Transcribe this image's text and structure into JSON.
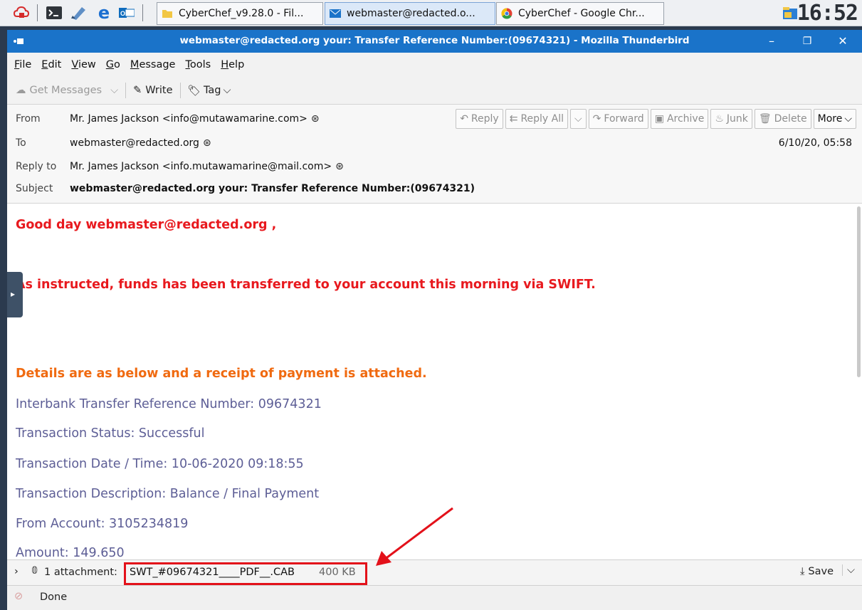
{
  "taskbar": {
    "tasks": [
      {
        "label": "CyberChef_v9.28.0 - Fil..."
      },
      {
        "label": "webmaster@redacted.o..."
      },
      {
        "label": "CyberChef - Google Chr..."
      }
    ],
    "clock": "16:52"
  },
  "window": {
    "title": "webmaster@redacted.org your: Transfer Reference Number:(09674321) - Mozilla Thunderbird",
    "minimize": "–",
    "restore": "❐",
    "close": "✕"
  },
  "menubar": {
    "items": [
      {
        "key": "F",
        "rest": "ile"
      },
      {
        "key": "E",
        "rest": "dit"
      },
      {
        "key": "V",
        "rest": "iew"
      },
      {
        "key": "G",
        "rest": "o"
      },
      {
        "key": "M",
        "rest": "essage"
      },
      {
        "key": "T",
        "rest": "ools"
      },
      {
        "key": "H",
        "rest": "elp"
      }
    ]
  },
  "toolbar": {
    "get_messages": "Get Messages",
    "write": "Write",
    "tag": "Tag"
  },
  "header": {
    "from_label": "From",
    "from_value": "Mr. James Jackson <info@mutawamarine.com>",
    "to_label": "To",
    "to_value": "webmaster@redacted.org",
    "replyto_label": "Reply to",
    "replyto_value": "Mr. James Jackson <info.mutawamarine@mail.com>",
    "subject_label": "Subject",
    "subject_value": "webmaster@redacted.org your: Transfer Reference Number:(09674321)",
    "date": "6/10/20, 05:58",
    "buttons": {
      "reply": "Reply",
      "reply_all": "Reply All",
      "forward": "Forward",
      "archive": "Archive",
      "junk": "Junk",
      "delete": "Delete",
      "more": "More"
    }
  },
  "body": {
    "greeting": "Good day webmaster@redacted.org ,",
    "instructed": "As instructed, funds has been transferred to your account this morning via SWIFT.",
    "details": "Details are as below and a receipt of payment is attached.",
    "ref": "Interbank Transfer Reference Number: 09674321",
    "status": "Transaction Status: Successful",
    "date": "Transaction Date / Time: 10-06-2020 09:18:55",
    "desc": "Transaction Description: Balance / Final Payment",
    "from_account": "From Account: 3105234819",
    "amount": "Amount: 149.650"
  },
  "attachments": {
    "count_label": "1 attachment:",
    "filename": "SWT_#09674321____PDF__.CAB",
    "size": "400 KB",
    "save": "Save"
  },
  "status": {
    "text": "Done"
  },
  "colors": {
    "titlebar": "#1a73c9",
    "alert_red": "#e8191e",
    "orange": "#f06a10",
    "slate": "#5d5e96",
    "annotation_red": "#e3111a"
  }
}
